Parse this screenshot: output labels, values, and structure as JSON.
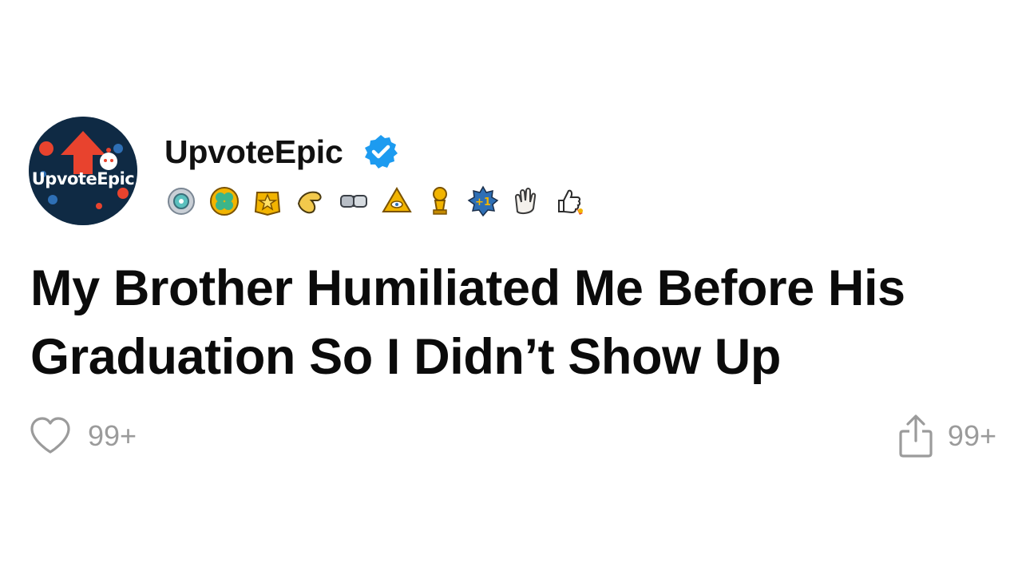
{
  "post": {
    "author": {
      "name": "UpvoteEpic",
      "avatar_text": "UpvoteEpic",
      "verified": true,
      "verified_color": "#1d9bf0"
    },
    "awards": [
      {
        "name": "silver-medal-award-icon"
      },
      {
        "name": "gold-clover-award-icon"
      },
      {
        "name": "gold-star-award-icon"
      },
      {
        "name": "pointing-hand-award-icon"
      },
      {
        "name": "bro-fist-award-icon"
      },
      {
        "name": "all-seeing-upvote-award-icon"
      },
      {
        "name": "trophy-award-icon"
      },
      {
        "name": "plus-one-award-icon"
      },
      {
        "name": "clapping-hands-award-icon"
      },
      {
        "name": "rocket-like-award-icon"
      }
    ],
    "title": "My Brother Humiliated Me Before His Graduation So I Didn’t Show Up",
    "likes": "99+",
    "shares": "99+"
  },
  "colors": {
    "avatar_bg": "#0f2a44",
    "upvote_arrow": "#e8432e",
    "muted": "#9b9b9b",
    "text": "#111111"
  }
}
